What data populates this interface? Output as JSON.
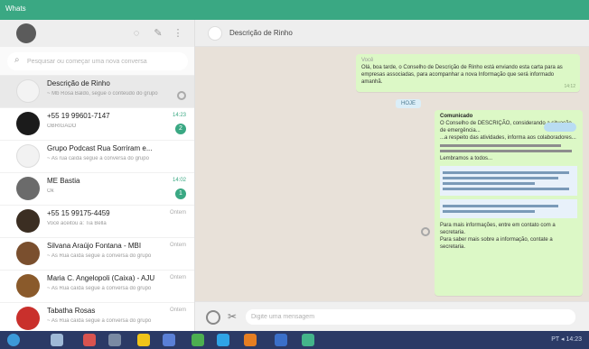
{
  "window": {
    "title": "Whats"
  },
  "left_header": {
    "icons": [
      "status-icon",
      "new-chat-icon",
      "menu-icon"
    ]
  },
  "search": {
    "placeholder": "Pesquisar ou começar uma nova conversa"
  },
  "chats": [
    {
      "name": "Descrição de Rinho",
      "preview": "~ Mb Rosa Baldo, segue o conteúdo do grupo",
      "time": "",
      "active": true,
      "indicator": "gear"
    },
    {
      "name": "+55 19 99601-7147",
      "preview": "OBRIGADO",
      "time": "14:23",
      "badge": "2",
      "avatar_color": "#1b1b1b"
    },
    {
      "name": "Grupo Podcast Rua Sorriram e...",
      "preview": "~ As rua caída segue a conversa do grupo",
      "time": "",
      "avatar_color": "#f2f2f2"
    },
    {
      "name": "ME Bastia",
      "preview": "Ok",
      "time": "14:02",
      "badge": "1",
      "avatar_color": "#6b6b6b"
    },
    {
      "name": "+55 15 99175-4459",
      "preview": "Você aceitou à: Tia Bella",
      "time": "Ontem",
      "avatar_color": "#3b2e22"
    },
    {
      "name": "Silvana Araújo Fontana - MBI",
      "preview": "~ As Rua caída segue a conversa do grupo",
      "time": "Ontem",
      "avatar_color": "#7a4f2e"
    },
    {
      "name": "Maria C. Angelopoli (Caixa) - AJU",
      "preview": "~ As Rua caída segue a conversa do grupo",
      "time": "Ontem",
      "avatar_color": "#8a5a2b"
    },
    {
      "name": "Tabatha Rosas",
      "preview": "~ As Rua caída segue a conversa do grupo",
      "time": "Ontem",
      "avatar_color": "#c9302c"
    }
  ],
  "conversation": {
    "name": "Descrição de Rinho",
    "messages": [
      {
        "sender": "Você",
        "text": "Olá, boa tarde, o Conselho de Descrição de Rinho está enviando esta carta para as empresas associadas, para acompanhar a nova Informação que será informado amanhã.",
        "time": "14:12"
      }
    ],
    "date_chip": "HOJE",
    "document": {
      "title": "Comunicado",
      "lines": [
        "O Conselho de DESCRIÇÃO, considerando a situação de emergência...",
        "...a respeito das atividades, informa aos colaboradores...",
        "Lembramos a todos...",
        "Para mais informações, entre em contato com a secretaria."
      ],
      "footer": "Para saber mais sobre a informação, contate a secretaria."
    }
  },
  "compose": {
    "placeholder": "Digite uma mensagem"
  },
  "taskbar": {
    "clock": "PT ◂ 14:23"
  }
}
